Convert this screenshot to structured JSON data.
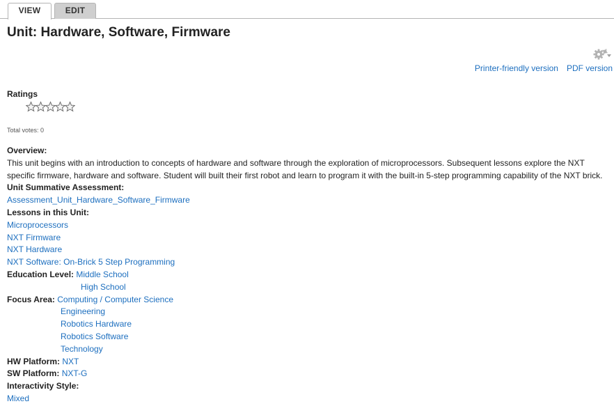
{
  "tabs": {
    "view": "VIEW",
    "edit": "EDIT"
  },
  "page": {
    "title": "Unit: Hardware, Software, Firmware"
  },
  "print_links": {
    "printer_friendly": "Printer-friendly version",
    "pdf": "PDF version"
  },
  "ratings": {
    "label": "Ratings",
    "stars_total": 5,
    "stars_filled": 0,
    "total_votes": "Total votes: 0"
  },
  "overview": {
    "label": "Overview:",
    "text": "This unit begins with an introduction to concepts of hardware and software through the exploration of microprocessors. Subsequent lessons explore the NXT specific firmware, hardware and software. Student will built their first robot and learn to program it with the built-in 5-step programming capability of the NXT brick."
  },
  "assessment": {
    "label": "Unit Summative Assessment:",
    "link": "Assessment_Unit_Hardware_Software_Firmware"
  },
  "lessons": {
    "label": "Lessons in this Unit:",
    "items": [
      "Microprocessors",
      "NXT Firmware",
      "NXT Hardware",
      "NXT Software: On-Brick 5 Step Programming"
    ]
  },
  "education_level": {
    "label": "Education Level:",
    "items": [
      "Middle School",
      "High School"
    ]
  },
  "focus_area": {
    "label": "Focus Area:",
    "items": [
      "Computing / Computer Science",
      "Engineering",
      "Robotics Hardware",
      "Robotics Software",
      "Technology"
    ]
  },
  "hw_platform": {
    "label": "HW Platform:",
    "value": "NXT"
  },
  "sw_platform": {
    "label": "SW Platform:",
    "value": "NXT-G"
  },
  "interactivity": {
    "label": "Interactivity Style:",
    "value": "Mixed"
  },
  "colors": {
    "link": "#1d6fbf",
    "tab_active_bg": "#ffffff",
    "tab_inactive_bg": "#cfcfcf"
  },
  "icons": {
    "settings": "gear-icon",
    "rating": "star-icon"
  }
}
